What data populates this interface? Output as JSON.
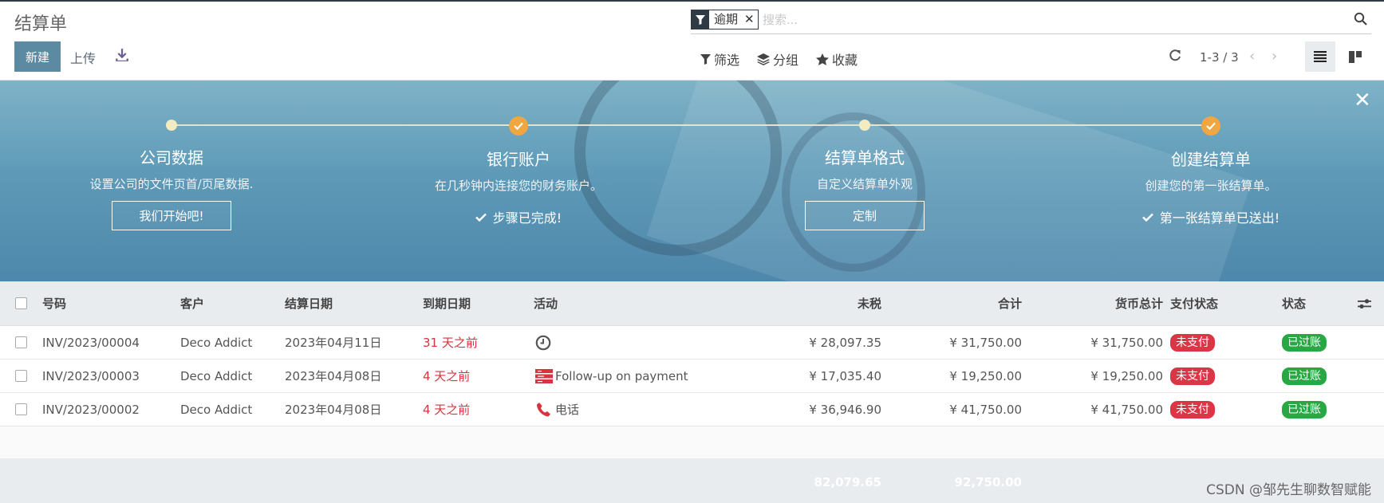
{
  "header": {
    "title": "结算单",
    "new_label": "新建",
    "upload_label": "上传"
  },
  "search": {
    "facet": "逾期",
    "facet_close": "✕",
    "placeholder": "搜索..."
  },
  "filters": {
    "filter_label": "筛选",
    "group_label": "分组",
    "favorite_label": "收藏"
  },
  "pager": {
    "value": "1-3 / 3"
  },
  "banner": {
    "steps": [
      {
        "title": "公司数据",
        "desc": "设置公司的文件页首/页尾数据.",
        "button": "我们开始吧!",
        "done": false
      },
      {
        "title": "银行账户",
        "desc": "在几秒钟内连接您的财务账户。",
        "done_text": "步骤已完成!",
        "done": true
      },
      {
        "title": "结算单格式",
        "desc": "自定义结算单外观",
        "button": "定制",
        "done": false
      },
      {
        "title": "创建结算单",
        "desc": "创建您的第一张结算单。",
        "done_text": "第一张结算单已送出!",
        "done": true
      }
    ]
  },
  "table": {
    "columns": {
      "number": "号码",
      "customer": "客户",
      "invoice_date": "结算日期",
      "due_date": "到期日期",
      "activity": "活动",
      "untaxed": "未税",
      "total": "合计",
      "currency_total": "货币总计",
      "payment_status": "支付状态",
      "status": "状态"
    },
    "rows": [
      {
        "number": "INV/2023/00004",
        "customer": "Deco Addict",
        "invoice_date": "2023年04月11日",
        "due_date": "31 天之前",
        "activity": "",
        "activity_icon": "clock-icon",
        "untaxed": "¥ 28,097.35",
        "total": "¥ 31,750.00",
        "currency_total": "¥ 31,750.00",
        "payment_status": "未支付",
        "status": "已过账"
      },
      {
        "number": "INV/2023/00003",
        "customer": "Deco Addict",
        "invoice_date": "2023年04月08日",
        "due_date": "4 天之前",
        "activity": "Follow-up on payment",
        "activity_icon": "tasks-icon",
        "untaxed": "¥ 17,035.40",
        "total": "¥ 19,250.00",
        "currency_total": "¥ 19,250.00",
        "payment_status": "未支付",
        "status": "已过账"
      },
      {
        "number": "INV/2023/00002",
        "customer": "Deco Addict",
        "invoice_date": "2023年04月08日",
        "due_date": "4 天之前",
        "activity": "电话",
        "activity_icon": "phone-icon",
        "untaxed": "¥ 36,946.90",
        "total": "¥ 41,750.00",
        "currency_total": "¥ 41,750.00",
        "payment_status": "未支付",
        "status": "已过账"
      }
    ],
    "footer": {
      "untaxed_sum": "82,079.65",
      "total_sum": "92,750.00"
    }
  },
  "watermark": "CSDN @邹先生聊数智赋能",
  "colors": {
    "primary": "#5c8aa2",
    "danger": "#dc3545",
    "success": "#28a745",
    "step_done": "#f0a641"
  }
}
